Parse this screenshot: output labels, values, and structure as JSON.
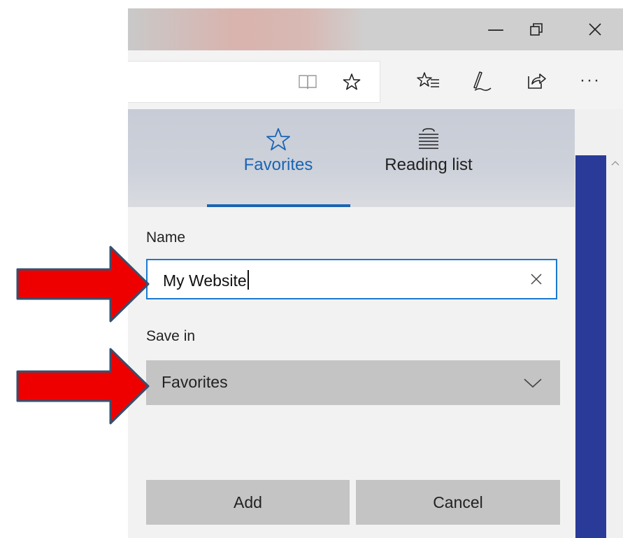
{
  "window": {
    "minimize_glyph": "—",
    "restore_glyph": "⧉",
    "close_glyph": "✕"
  },
  "toolbar": {
    "icons": [
      "reading-view-icon",
      "favorite-star-icon",
      "favorites-hub-icon",
      "web-note-icon",
      "share-icon",
      "more-icon"
    ],
    "more_glyph": "···"
  },
  "panel": {
    "tabs": [
      {
        "label": "Favorites",
        "icon": "star-outline-icon",
        "active": true
      },
      {
        "label": "Reading list",
        "icon": "reading-list-icon",
        "active": false
      }
    ],
    "name_label": "Name",
    "name_value": "My Website",
    "save_in_label": "Save in",
    "save_in_value": "Favorites",
    "add_label": "Add",
    "cancel_label": "Cancel"
  },
  "colors": {
    "accent": "#1a64b4",
    "input_border": "#1a7ad1",
    "arrow_fill": "#ee0000",
    "arrow_stroke": "#35506e",
    "page_blue": "#2a3a99"
  }
}
